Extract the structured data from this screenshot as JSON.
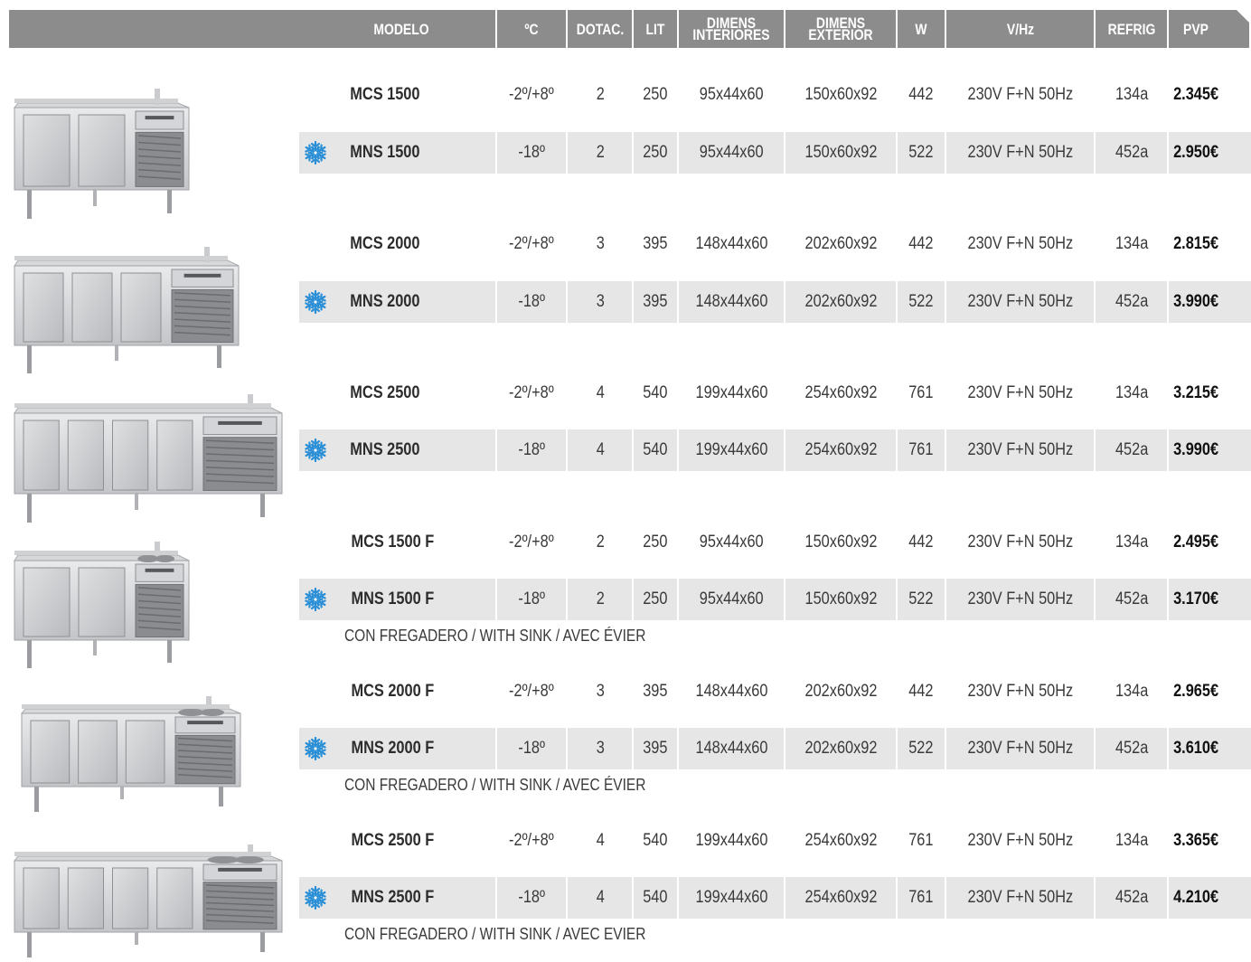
{
  "headers": {
    "modelo": "MODELO",
    "temp": "ºC",
    "dotac": "DOTAC.",
    "lit": "LIT",
    "dim_int_1": "DIMENS",
    "dim_int_2": "INTERIORES",
    "dim_ext_1": "DIMENS",
    "dim_ext_2": "EXTERIOR",
    "w": "W",
    "vhz": "V/Hz",
    "refrig": "REFRIG",
    "pvp": "PVP"
  },
  "groups": [
    {
      "rows": [
        {
          "model": "MCS 1500",
          "temp": "-2º/+8º",
          "dotac": "2",
          "lit": "250",
          "dim_int": "95x44x60",
          "dim_ext": "150x60x92",
          "w": "442",
          "vhz": "230V F+N 50Hz",
          "refrig": "134a",
          "pvp": "2.345€"
        },
        {
          "model": "MNS 1500",
          "temp": "-18º",
          "dotac": "2",
          "lit": "250",
          "dim_int": "95x44x60",
          "dim_ext": "150x60x92",
          "w": "522",
          "vhz": "230V F+N 50Hz",
          "refrig": "452a",
          "pvp": "2.950€"
        }
      ]
    },
    {
      "rows": [
        {
          "model": "MCS 2000",
          "temp": "-2º/+8º",
          "dotac": "3",
          "lit": "395",
          "dim_int": "148x44x60",
          "dim_ext": "202x60x92",
          "w": "442",
          "vhz": "230V F+N 50Hz",
          "refrig": "134a",
          "pvp": "2.815€"
        },
        {
          "model": "MNS 2000",
          "temp": "-18º",
          "dotac": "3",
          "lit": "395",
          "dim_int": "148x44x60",
          "dim_ext": "202x60x92",
          "w": "522",
          "vhz": "230V F+N 50Hz",
          "refrig": "452a",
          "pvp": "3.990€"
        }
      ]
    },
    {
      "rows": [
        {
          "model": "MCS 2500",
          "temp": "-2º/+8º",
          "dotac": "4",
          "lit": "540",
          "dim_int": "199x44x60",
          "dim_ext": "254x60x92",
          "w": "761",
          "vhz": "230V F+N 50Hz",
          "refrig": "134a",
          "pvp": "3.215€"
        },
        {
          "model": "MNS 2500",
          "temp": "-18º",
          "dotac": "4",
          "lit": "540",
          "dim_int": "199x44x60",
          "dim_ext": "254x60x92",
          "w": "761",
          "vhz": "230V F+N 50Hz",
          "refrig": "452a",
          "pvp": "3.990€"
        }
      ]
    },
    {
      "rows": [
        {
          "model": "MCS 1500 F",
          "temp": "-2º/+8º",
          "dotac": "2",
          "lit": "250",
          "dim_int": "95x44x60",
          "dim_ext": "150x60x92",
          "w": "442",
          "vhz": "230V F+N 50Hz",
          "refrig": "134a",
          "pvp": "2.495€"
        },
        {
          "model": "MNS 1500 F",
          "temp": "-18º",
          "dotac": "2",
          "lit": "250",
          "dim_int": "95x44x60",
          "dim_ext": "150x60x92",
          "w": "522",
          "vhz": "230V F+N 50Hz",
          "refrig": "452a",
          "pvp": "3.170€"
        }
      ],
      "note": "CON FREGADERO / WITH SINK / AVEC ÉVIER"
    },
    {
      "rows": [
        {
          "model": "MCS 2000 F",
          "temp": "-2º/+8º",
          "dotac": "3",
          "lit": "395",
          "dim_int": "148x44x60",
          "dim_ext": "202x60x92",
          "w": "442",
          "vhz": "230V F+N 50Hz",
          "refrig": "134a",
          "pvp": "2.965€"
        },
        {
          "model": "MNS 2000 F",
          "temp": "-18º",
          "dotac": "3",
          "lit": "395",
          "dim_int": "148x44x60",
          "dim_ext": "202x60x92",
          "w": "522",
          "vhz": "230V F+N 50Hz",
          "refrig": "452a",
          "pvp": "3.610€"
        }
      ],
      "note": "CON FREGADERO / WITH SINK / AVEC ÉVIER"
    },
    {
      "rows": [
        {
          "model": "MCS 2500 F",
          "temp": "-2º/+8º",
          "dotac": "4",
          "lit": "540",
          "dim_int": "199x44x60",
          "dim_ext": "254x60x92",
          "w": "761",
          "vhz": "230V F+N 50Hz",
          "refrig": "134a",
          "pvp": "3.365€"
        },
        {
          "model": "MNS 2500 F",
          "temp": "-18º",
          "dotac": "4",
          "lit": "540",
          "dim_int": "199x44x60",
          "dim_ext": "254x60x92",
          "w": "761",
          "vhz": "230V F+N 50Hz",
          "refrig": "452a",
          "pvp": "4.210€"
        }
      ],
      "note": "CON FREGADERO / WITH SINK / AVEC EVIER"
    }
  ],
  "colors": {
    "header_bg": "#8c8c8c",
    "row_alt_bg": "#e6e6e6",
    "snowflake": "#2a8fd6"
  },
  "icons": {
    "freezer_marker": "snowflake-icon",
    "product": "refrigerated-counter-image"
  }
}
